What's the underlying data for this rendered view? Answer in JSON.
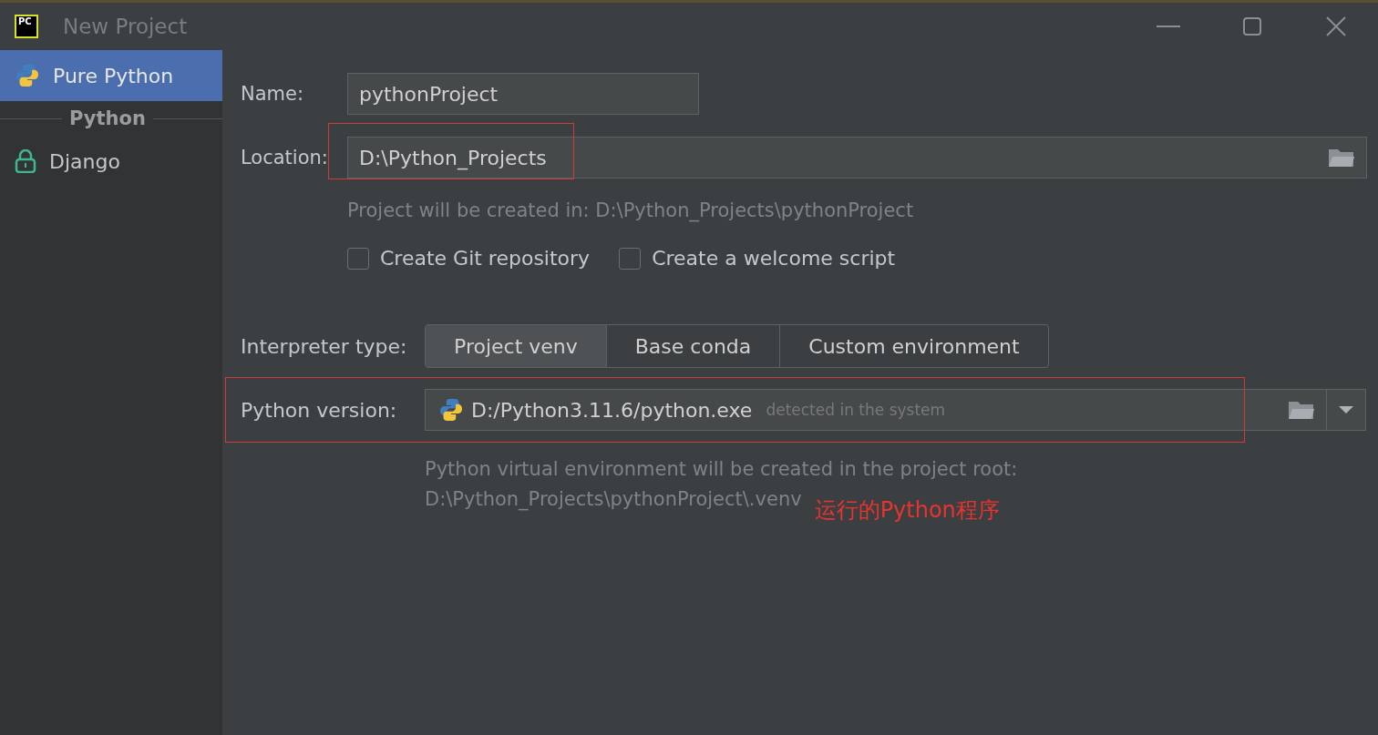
{
  "window": {
    "logo": "PC",
    "title": "New Project"
  },
  "sidebar": {
    "items": [
      {
        "kind": "item",
        "label": "Pure Python",
        "selected": true
      },
      {
        "kind": "header",
        "label": "Python"
      },
      {
        "kind": "item",
        "label": "Django",
        "selected": false
      }
    ]
  },
  "form": {
    "name": {
      "label": "Name:",
      "value": "pythonProject"
    },
    "location": {
      "label": "Location:",
      "value": "D:\\Python_Projects"
    },
    "location_hint": "Project will be created in: D:\\Python_Projects\\pythonProject",
    "checkboxes": [
      {
        "label": "Create Git repository",
        "checked": false
      },
      {
        "label": "Create a welcome script",
        "checked": false
      }
    ],
    "interpreter": {
      "label": "Interpreter type:",
      "options": [
        {
          "label": "Project venv",
          "selected": true
        },
        {
          "label": "Base conda",
          "selected": false
        },
        {
          "label": "Custom environment",
          "selected": false
        }
      ]
    },
    "python_version": {
      "label": "Python version:",
      "value": "D:/Python3.11.6/python.exe",
      "note": "detected in the system"
    },
    "venv_hint": [
      "Python virtual environment will be created in the project root:",
      "D:\\Python_Projects\\pythonProject\\.venv"
    ],
    "annotation": "运行的Python程序"
  }
}
